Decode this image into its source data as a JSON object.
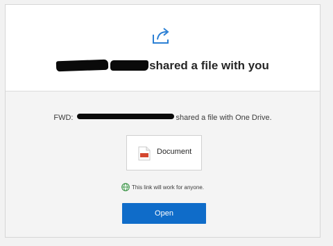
{
  "header": {
    "title_suffix": "shared a file with you"
  },
  "message": {
    "prefix": "FWD:",
    "suffix": "shared a file with One Drive."
  },
  "file": {
    "name": "Document",
    "icon": "pdf-document-icon"
  },
  "link_note": {
    "text": "This link will work for anyone.",
    "icon": "globe-icon"
  },
  "actions": {
    "open_label": "Open"
  },
  "colors": {
    "accent": "#0f6cc9",
    "share_icon": "#2b7fd4",
    "globe": "#2e8b3a",
    "file_icon": "#d4472f"
  }
}
